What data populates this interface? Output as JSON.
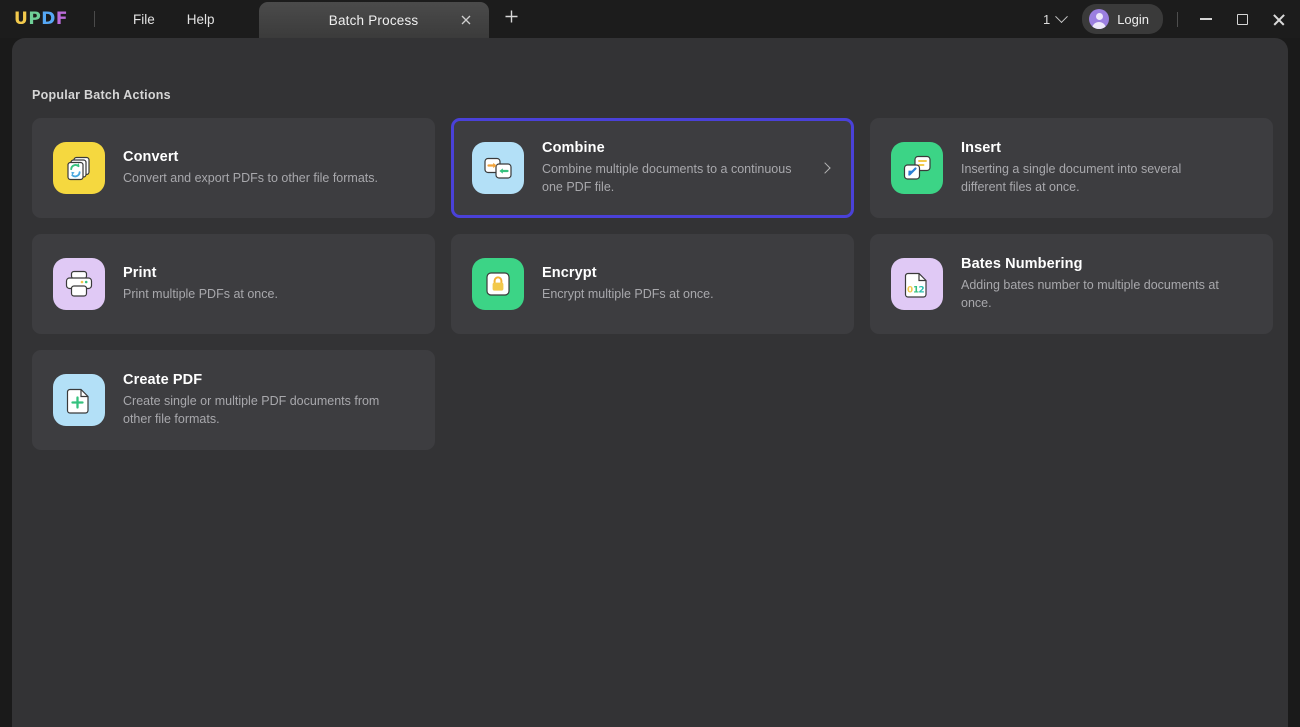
{
  "titlebar": {
    "logo": [
      "U",
      "P",
      "D",
      "F"
    ],
    "menus": [
      {
        "label": "File",
        "name": "menu-file"
      },
      {
        "label": "Help",
        "name": "menu-help"
      }
    ],
    "tab": {
      "label": "Batch Process",
      "close_icon": "close-icon",
      "new_tab_icon": "plus-icon"
    },
    "page_count": "1",
    "login_label": "Login",
    "window_controls": {
      "minimize": "minimize-icon",
      "maximize": "maximize-icon",
      "close": "close-icon"
    }
  },
  "main": {
    "section_title": "Popular Batch Actions",
    "cards": [
      {
        "id": "convert",
        "title": "Convert",
        "desc": "Convert and export PDFs to other file formats.",
        "icon": "convert-icon",
        "icon_bg": "#f5d83f",
        "selected": false,
        "has_arrow": false
      },
      {
        "id": "combine",
        "title": "Combine",
        "desc": "Combine multiple documents to a continuous one PDF file.",
        "icon": "combine-icon",
        "icon_bg": "#b3e0f7",
        "selected": true,
        "has_arrow": true
      },
      {
        "id": "insert",
        "title": "Insert",
        "desc": "Inserting a single document into several different files at once.",
        "icon": "insert-icon",
        "icon_bg": "#3cd486",
        "selected": false,
        "has_arrow": false
      },
      {
        "id": "print",
        "title": "Print",
        "desc": "Print multiple PDFs at once.",
        "icon": "print-icon",
        "icon_bg": "#e0c9f5",
        "selected": false,
        "has_arrow": false
      },
      {
        "id": "encrypt",
        "title": "Encrypt",
        "desc": "Encrypt multiple PDFs at once.",
        "icon": "encrypt-icon",
        "icon_bg": "#3cd486",
        "selected": false,
        "has_arrow": false
      },
      {
        "id": "bates-numbering",
        "title": "Bates Numbering",
        "desc": "Adding bates number to multiple documents at once.",
        "icon": "bates-numbering-icon",
        "icon_bg": "#e0c9f5",
        "selected": false,
        "has_arrow": false,
        "icon_digits": "012"
      },
      {
        "id": "create-pdf",
        "title": "Create PDF",
        "desc": "Create single or multiple PDF documents from other file formats.",
        "icon": "create-pdf-icon",
        "icon_bg": "#b3e0f7",
        "selected": false,
        "has_arrow": false
      }
    ]
  },
  "colors": {
    "accent_selected": "#4a41d8",
    "card_bg": "#3d3d40",
    "panel_bg": "#333335",
    "titlebar_bg": "#1c1c1c"
  }
}
